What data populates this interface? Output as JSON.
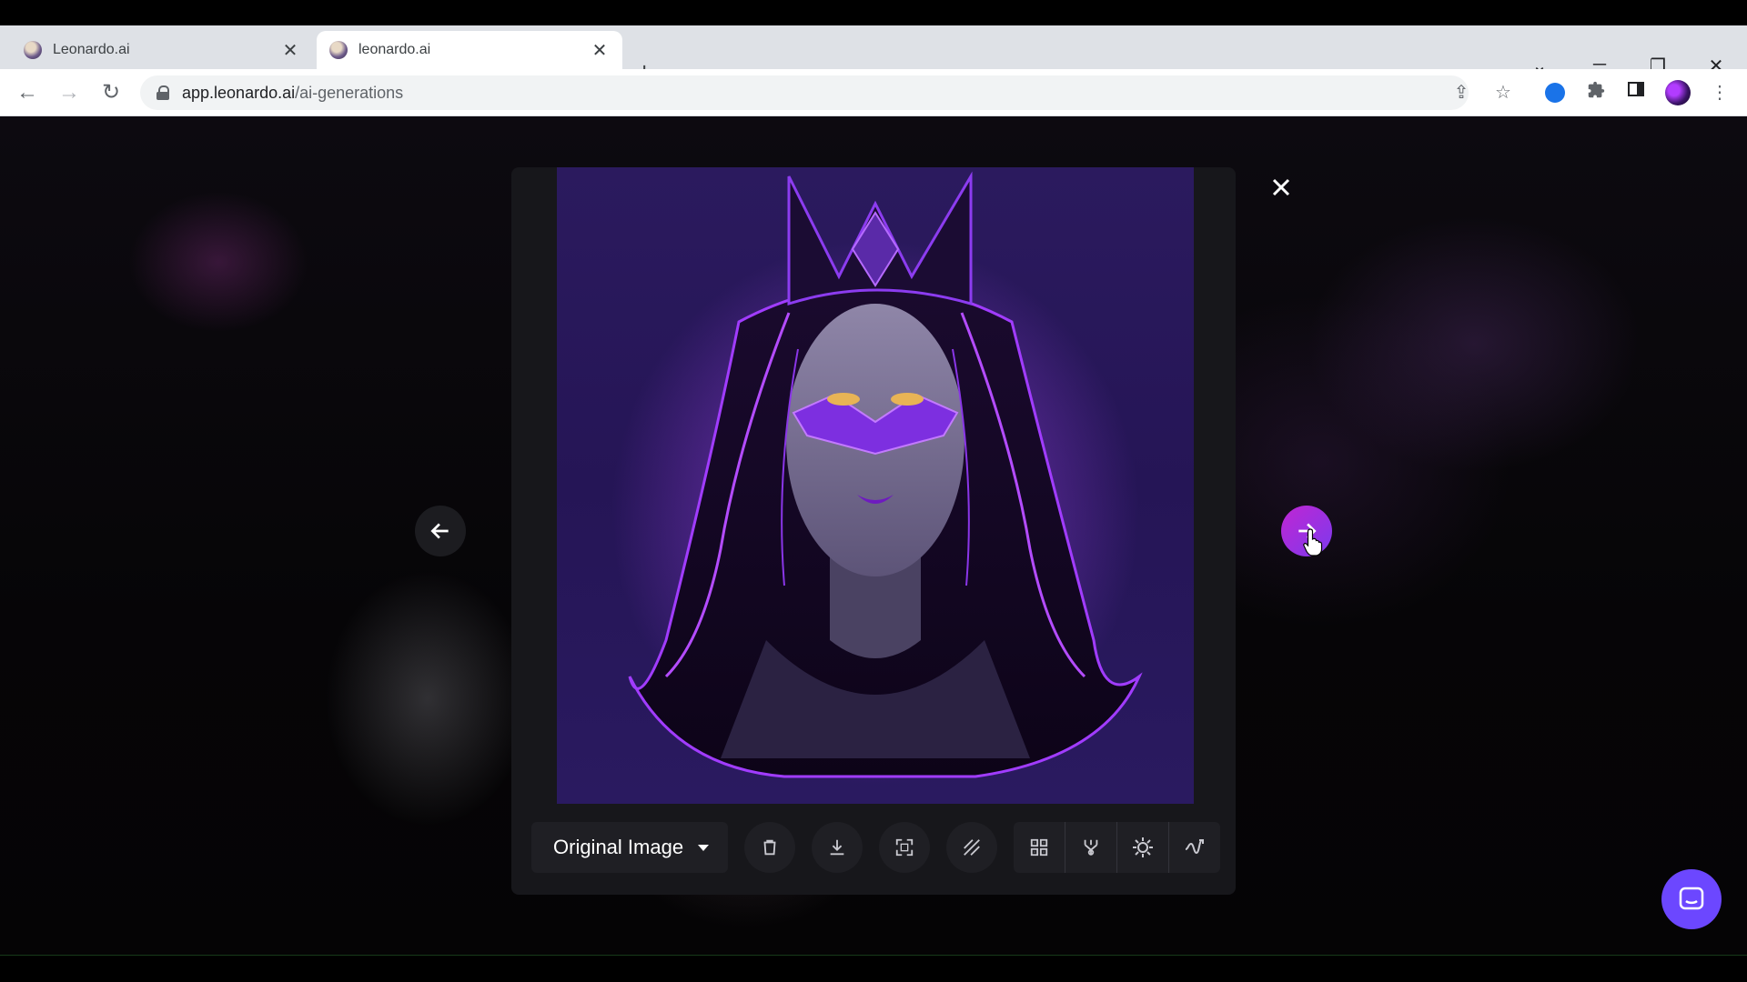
{
  "browser": {
    "tabs": [
      {
        "title": "Leonardo.ai",
        "active": false
      },
      {
        "title": "leonardo.ai",
        "active": true
      }
    ],
    "url_host": "app.leonardo.ai",
    "url_path": "/ai-generations"
  },
  "viewer": {
    "image_mode": "Original Image",
    "toolbar_icons": [
      "trash-icon",
      "download-icon",
      "fullscreen-icon",
      "remove-background-icon",
      "upscale-grid-icon",
      "alchemy-upscale-icon",
      "creative-upscale-icon",
      "unzoom-icon"
    ]
  },
  "colors": {
    "accent_gradient_start": "#c026d3",
    "accent_gradient_end": "#7c3aed",
    "chat_button": "#6c47ff",
    "modal_bg": "#17171b"
  }
}
